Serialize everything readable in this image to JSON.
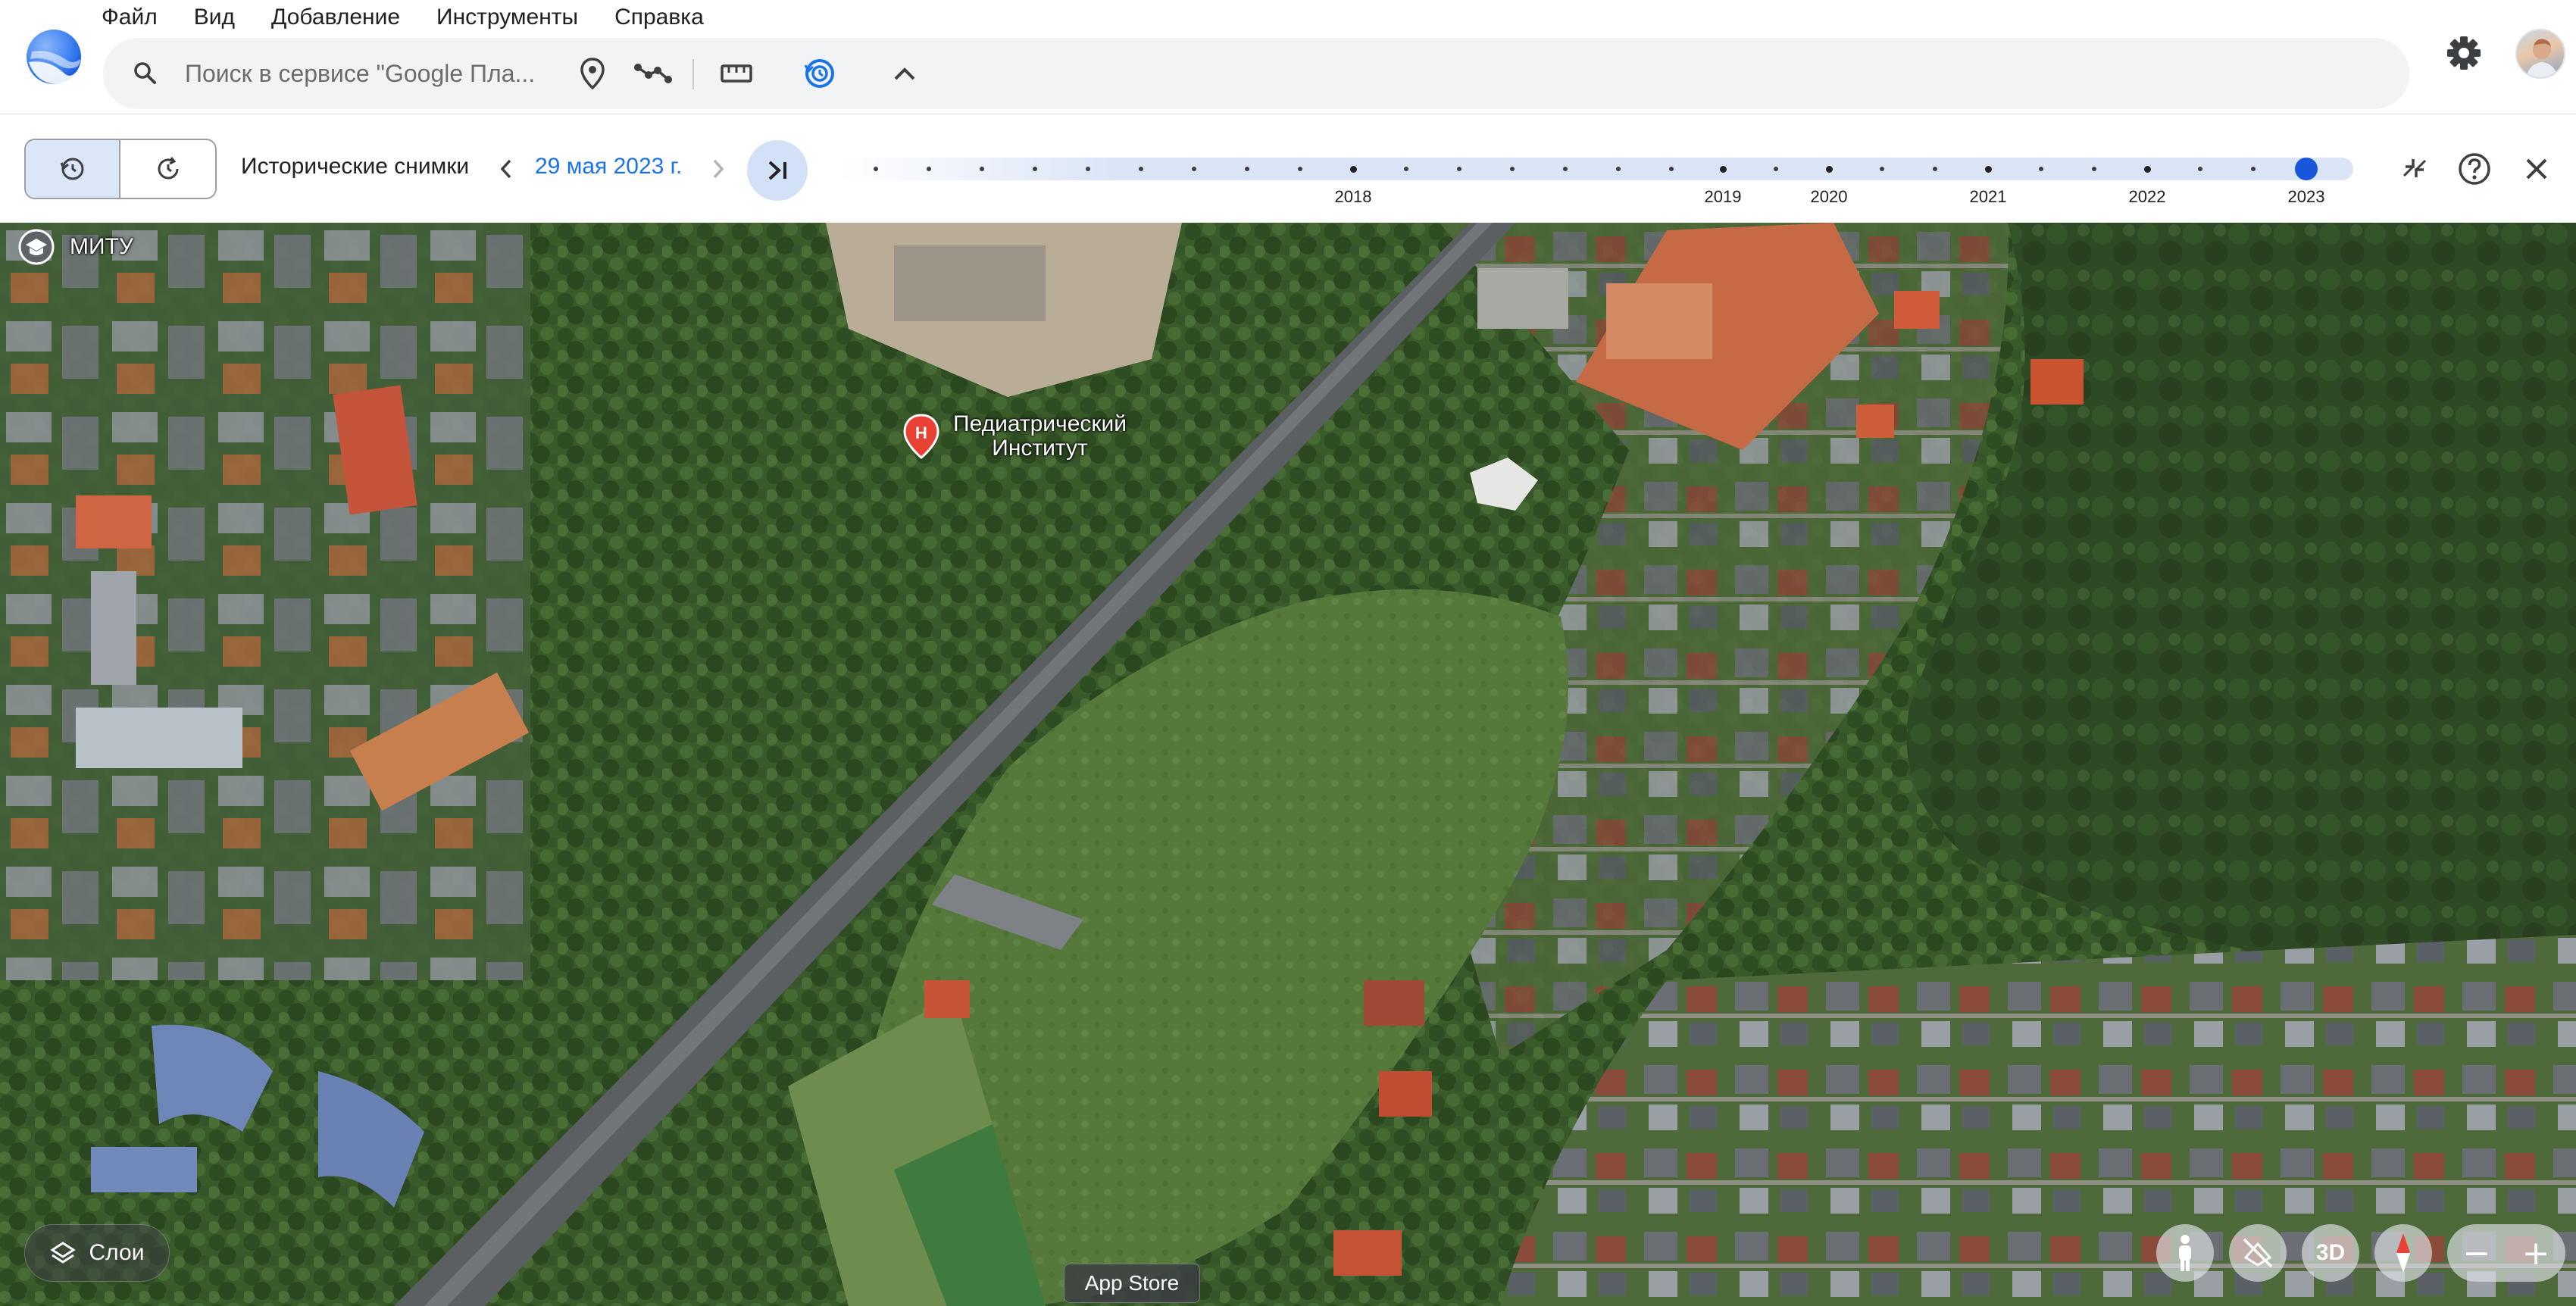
{
  "menu": {
    "items": [
      "Файл",
      "Вид",
      "Добавление",
      "Инструменты",
      "Справка"
    ]
  },
  "search": {
    "placeholder": "Поиск в сервисе \"Google Пла..."
  },
  "toolbar": {
    "icons": [
      "search-icon",
      "placemark-icon",
      "path-icon",
      "ruler-icon",
      "historical-imagery-icon",
      "chevron-up-icon",
      "gear-icon"
    ]
  },
  "history": {
    "label": "Исторические снимки",
    "current_date": "29 мая 2023 г.",
    "timeline_years": [
      "2018",
      "2019",
      "2020",
      "2021",
      "2022",
      "2023"
    ],
    "selected_year": "2023"
  },
  "map": {
    "place_label_1": "МИТУ",
    "poi_label_line1": "Педиатрический",
    "poi_label_line2": "Институт",
    "poi_badge": "H"
  },
  "bottom": {
    "layers_label": "Слои",
    "appstore_label": "App Store",
    "btn_3d_label": "3D",
    "zoom_out": "−",
    "zoom_in": "+"
  },
  "colors": {
    "accent": "#1a73e8",
    "timeline_thumb": "#1a56db",
    "poi_red": "#e94235"
  }
}
